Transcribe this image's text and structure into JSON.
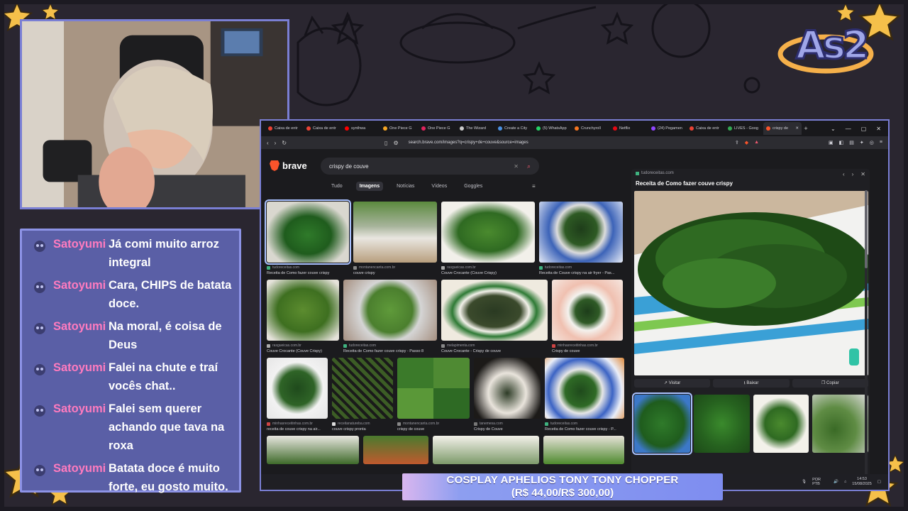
{
  "overlay": {
    "logo_text": "As2",
    "colors": {
      "accent": "#7a7fd4",
      "chat_bg": "#5a5fa6",
      "username": "#ff7bbf",
      "star": "#f5c04a"
    }
  },
  "chat": {
    "messages": [
      {
        "user": "Satoyumi",
        "text": "Já comi muito arroz integral"
      },
      {
        "user": "Satoyumi",
        "text": "Cara, CHIPS de batata doce."
      },
      {
        "user": "Satoyumi",
        "text": "Na moral, é coisa de Deus"
      },
      {
        "user": "Satoyumi",
        "text": "Falei na chute e traí vocês chat.."
      },
      {
        "user": "Satoyumi",
        "text": "Falei sem querer achando que tava na roxa"
      },
      {
        "user": "Satoyumi",
        "text": "Batata doce é muito forte, eu gosto muito."
      }
    ]
  },
  "browser": {
    "tabs": [
      {
        "label": "Caixa de entr",
        "color": "#ea4335"
      },
      {
        "label": "Caixa de entr",
        "color": "#ea4335"
      },
      {
        "label": "synthwa",
        "color": "#ff0000"
      },
      {
        "label": "One Piece G",
        "color": "#f5a623"
      },
      {
        "label": "One Piece G",
        "color": "#e0245e"
      },
      {
        "label": "The Wizard",
        "color": "#cccccc"
      },
      {
        "label": "Create a City",
        "color": "#4a90e2"
      },
      {
        "label": "(5) WhatsApp",
        "color": "#25d366"
      },
      {
        "label": "Crunchyroll",
        "color": "#f47521"
      },
      {
        "label": "Netflix",
        "color": "#e50914"
      },
      {
        "label": "(24) Pegamen",
        "color": "#9146ff"
      },
      {
        "label": "Caixa de entr",
        "color": "#ea4335"
      },
      {
        "label": "LIVES - Goog",
        "color": "#34a853"
      },
      {
        "label": "crispy de",
        "color": "#fb542b",
        "active": true
      }
    ],
    "url": "search.brave.com/images?q=crispy+de+couve&source=images",
    "brand": "brave",
    "search_query": "crispy de couve",
    "filters": [
      {
        "label": "Tudo"
      },
      {
        "label": "Imagens",
        "active": true
      },
      {
        "label": "Notícias"
      },
      {
        "label": "Vídeos"
      },
      {
        "label": "Goggles"
      }
    ],
    "results": [
      [
        {
          "source": "tudoreceitas.com",
          "caption": "Receita de Como fazer couve crispy",
          "selected": true
        },
        {
          "source": "montanencanta.com.br",
          "caption": "couve crispy"
        },
        {
          "source": "rasgueicas.com.br",
          "caption": "Couve Crocante (Couve Crispy)"
        },
        {
          "source": "tudoreceitas.com",
          "caption": "Receita de Couve crispy na air fryer - Pas..."
        }
      ],
      [
        {
          "source": "rasgueicas.com.br",
          "caption": "Couve Crocante (Couve Crispy)"
        },
        {
          "source": "tudoreceitas.com",
          "caption": "Receita de Como fazer couve crispy - Passo 8"
        },
        {
          "source": "melapimenta.com",
          "caption": "Couve Crocante - Crispy de couve"
        },
        {
          "source": "minhasreceitinhas.com.br",
          "caption": "Crispy de couve"
        }
      ],
      [
        {
          "source": "minhasreceitinhas.com.br",
          "caption": "receita de couve crispy na air..."
        },
        {
          "source": "receitanatureba.com",
          "caption": "couve crispy pronta"
        },
        {
          "source": "montanencanta.com.br",
          "caption": "crispy de couve"
        },
        {
          "source": "tanemesa.com",
          "caption": "Crispy de Couve"
        },
        {
          "source": "tudoreceitas.com",
          "caption": "Receita de Como fazer couve crispy - P..."
        }
      ]
    ],
    "preview": {
      "source": "tudoreceitas.com",
      "title": "Receita de Como fazer couve crispy",
      "actions": [
        "Visitar",
        "Baixar",
        "Copiar"
      ]
    },
    "taskbar": {
      "lang": "POR PTB",
      "time": "14:53",
      "date": "15/08/2025"
    }
  },
  "ticker": {
    "line1": "COSPLAY APHELIOS TONY TONY CHOPPER",
    "line2": "(R$ 44,00/R$ 300,00)"
  }
}
